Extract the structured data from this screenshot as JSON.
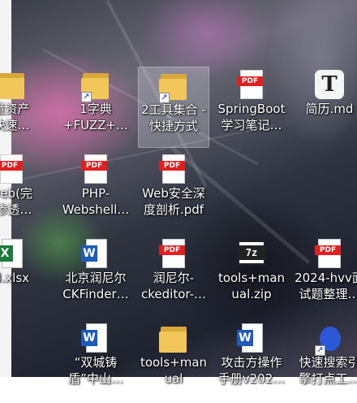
{
  "desktop": {
    "items": [
      {
        "label": "量资产\n快速…",
        "icon": "folder-icon",
        "type": "folder",
        "shortcut": false,
        "selected": false
      },
      {
        "label": "1字典\n+FUZZ+…",
        "icon": "folder-icon",
        "type": "folder",
        "shortcut": true,
        "selected": false
      },
      {
        "label": "2工具集合 -\n快捷方式",
        "icon": "folder-icon",
        "type": "folder",
        "shortcut": true,
        "selected": true
      },
      {
        "label": "SpringBoot\n学习笔记…",
        "icon": "pdf-icon",
        "type": "pdf",
        "shortcut": false,
        "selected": false
      },
      {
        "label": "简历.md",
        "icon": "typora-icon",
        "type": "md",
        "shortcut": false,
        "selected": false
      },
      {
        "label": "web(完\n)渗透…",
        "icon": "pdf-icon",
        "type": "pdf",
        "shortcut": false,
        "selected": false
      },
      {
        "label": "PHP-\nWebshell…",
        "icon": "pdf-icon",
        "type": "pdf",
        "shortcut": false,
        "selected": false
      },
      {
        "label": "Web安全深\n度剖析.pdf",
        "icon": "pdf-icon",
        "type": "pdf",
        "shortcut": false,
        "selected": false
      },
      {
        "label": "d.xlsx",
        "icon": "excel-icon",
        "type": "xlsx",
        "shortcut": false,
        "selected": false
      },
      {
        "label": "北京润尼尔\nCKFinder…",
        "icon": "word-icon",
        "type": "docx",
        "shortcut": false,
        "selected": false
      },
      {
        "label": "润尼尔-\nckeditor-…",
        "icon": "pdf-icon",
        "type": "pdf",
        "shortcut": false,
        "selected": false
      },
      {
        "label": "tools+man\nual.zip",
        "icon": "zip-icon",
        "type": "zip",
        "shortcut": false,
        "selected": false
      },
      {
        "label": "2024-hvv面\n试题整理…",
        "icon": "pdf-icon",
        "type": "pdf",
        "shortcut": false,
        "selected": false
      },
      {
        "label": "“双城铸\n盾”中山…",
        "icon": "word-icon",
        "type": "docx",
        "shortcut": false,
        "selected": false
      },
      {
        "label": "tools+man\nual",
        "icon": "folder-icon",
        "type": "folder",
        "shortcut": false,
        "selected": false
      },
      {
        "label": "攻击方操作\n手册v202…",
        "icon": "word-icon",
        "type": "docx",
        "shortcut": false,
        "selected": false
      },
      {
        "label": "快速搜索引\n擎打点工…",
        "icon": "tool-icon",
        "type": "exe",
        "shortcut": true,
        "selected": false
      }
    ],
    "pdf_badge": "PDF",
    "word_badge": "W",
    "excel_badge": "X",
    "zip_badge": "7z",
    "typora_badge": "T",
    "shortcut_arrow": "↗"
  }
}
